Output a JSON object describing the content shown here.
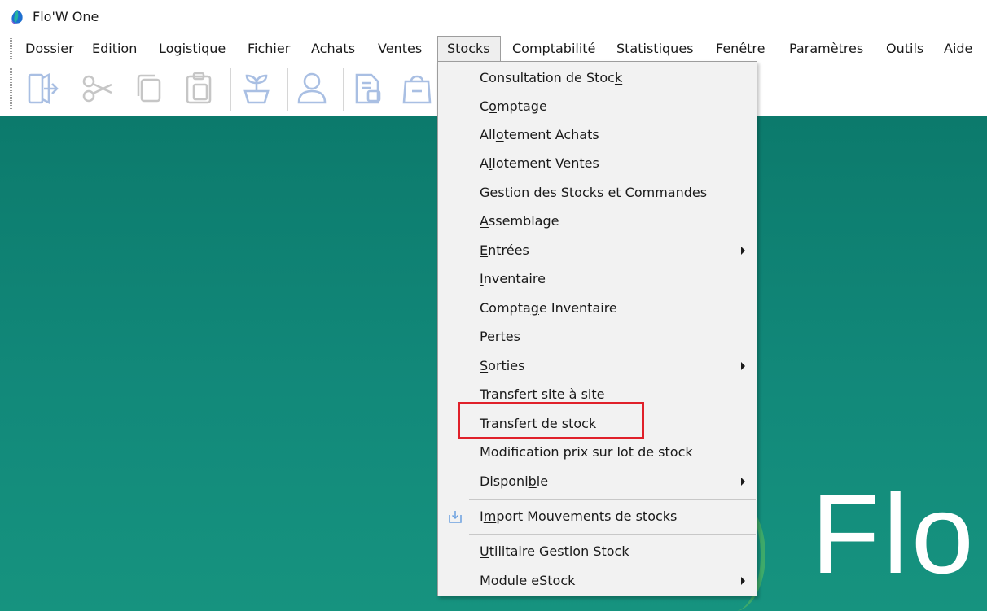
{
  "window": {
    "title": "Flo'W One",
    "logo_icon": "flow-logo-icon"
  },
  "menubar": {
    "items": [
      {
        "label": "Dossier"
      },
      {
        "label": "Edition"
      },
      {
        "label": "Logistique"
      },
      {
        "label": "Fichier"
      },
      {
        "label": "Achats"
      },
      {
        "label": "Ventes"
      },
      {
        "label": "Stocks"
      },
      {
        "label": "Comptabilité"
      },
      {
        "label": "Statistiques"
      },
      {
        "label": "Fenêtre"
      },
      {
        "label": "Paramètres"
      },
      {
        "label": "Outils"
      },
      {
        "label": "Aide"
      }
    ],
    "open_menu": "Stocks"
  },
  "toolbar": {
    "icons": [
      "exit-icon",
      "cut-icon",
      "copy-icon",
      "paste-icon",
      "plant-pot-icon",
      "user-icon",
      "document-icon",
      "shopping-bag-icon"
    ]
  },
  "stocks_menu": {
    "items": [
      {
        "label": "Consultation de Stock"
      },
      {
        "label": "Comptage"
      },
      {
        "label": "Allotement Achats"
      },
      {
        "label": "Allotement Ventes"
      },
      {
        "label": "Gestion des Stocks et Commandes"
      },
      {
        "label": "Assemblage"
      },
      {
        "label": "Entrées",
        "submenu": true
      },
      {
        "label": "Inventaire"
      },
      {
        "label": "Comptage Inventaire"
      },
      {
        "label": "Pertes"
      },
      {
        "label": "Sorties",
        "submenu": true
      },
      {
        "label": "Transfert site à site"
      },
      {
        "label": "Transfert de stock",
        "highlighted": true
      },
      {
        "label": "Modification prix sur lot de stock"
      },
      {
        "label": "Disponible",
        "submenu": true
      },
      {
        "label": "Import Mouvements de stocks",
        "icon": "import-icon"
      },
      {
        "label": "Utilitaire Gestion Stock"
      },
      {
        "label": "Module eStock",
        "submenu": true
      }
    ]
  },
  "workspace": {
    "brand_text": "Flo",
    "background_color": "#0f8373",
    "highlight_color": "#e0202a"
  }
}
